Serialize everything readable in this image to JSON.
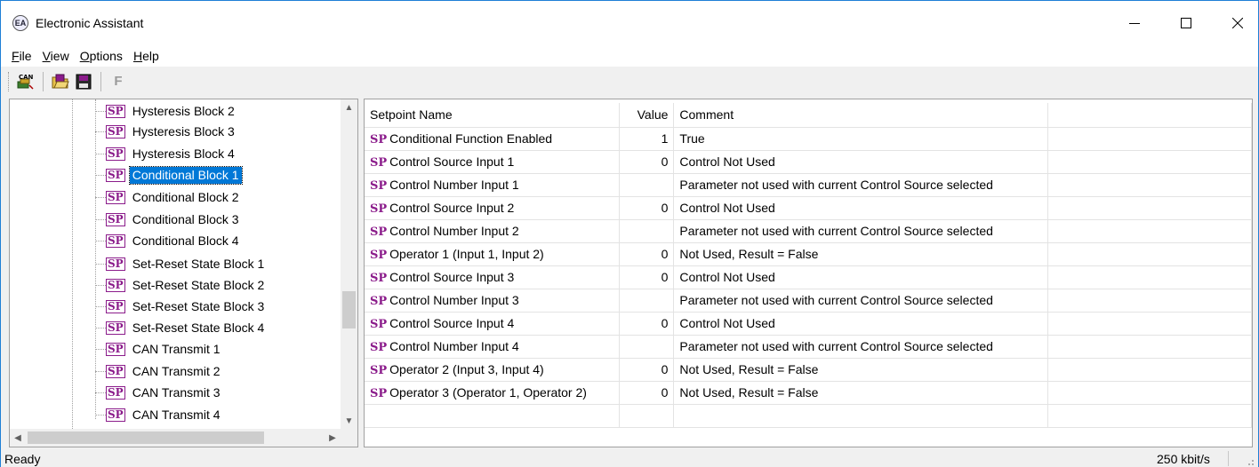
{
  "window": {
    "title": "Electronic Assistant",
    "app_icon": "EA"
  },
  "menu": {
    "items": [
      {
        "key": "F",
        "rest": "ile"
      },
      {
        "key": "V",
        "rest": "iew"
      },
      {
        "key": "O",
        "rest": "ptions"
      },
      {
        "key": "H",
        "rest": "elp"
      }
    ]
  },
  "toolbar": {
    "can_label": "CAN",
    "f_label": "F"
  },
  "tree": {
    "badge": "SP",
    "items": [
      "Hysteresis Block 2",
      "Hysteresis Block 3",
      "Hysteresis Block 4",
      "Conditional Block 1",
      "Conditional Block 2",
      "Conditional Block 3",
      "Conditional Block 4",
      "Set-Reset State Block 1",
      "Set-Reset State Block 2",
      "Set-Reset State Block 3",
      "Set-Reset State Block 4",
      "CAN Transmit 1",
      "CAN Transmit 2",
      "CAN Transmit 3",
      "CAN Transmit 4"
    ],
    "selected_index": 3
  },
  "grid": {
    "headers": {
      "name": "Setpoint Name",
      "value": "Value",
      "comment": "Comment"
    },
    "badge": "SP",
    "rows": [
      {
        "name": "Conditional Function Enabled",
        "value": "1",
        "comment": "True"
      },
      {
        "name": "Control Source Input 1",
        "value": "0",
        "comment": "Control Not Used"
      },
      {
        "name": "Control Number Input 1",
        "value": "",
        "comment": "Parameter not used with current Control Source selected"
      },
      {
        "name": "Control Source Input 2",
        "value": "0",
        "comment": "Control Not Used"
      },
      {
        "name": "Control Number Input 2",
        "value": "",
        "comment": "Parameter not used with current Control Source selected"
      },
      {
        "name": "Operator 1 (Input 1, Input 2)",
        "value": "0",
        "comment": "Not Used, Result = False"
      },
      {
        "name": "Control Source Input 3",
        "value": "0",
        "comment": "Control Not Used"
      },
      {
        "name": "Control Number Input 3",
        "value": "",
        "comment": "Parameter not used with current Control Source selected"
      },
      {
        "name": "Control Source Input 4",
        "value": "0",
        "comment": "Control Not Used"
      },
      {
        "name": "Control Number Input 4",
        "value": "",
        "comment": "Parameter not used with current Control Source selected"
      },
      {
        "name": "Operator 2 (Input 3, Input 4)",
        "value": "0",
        "comment": "Not Used, Result = False"
      },
      {
        "name": "Operator 3 (Operator 1, Operator 2)",
        "value": "0",
        "comment": "Not Used, Result = False"
      }
    ]
  },
  "status": {
    "left": "Ready",
    "right": "250 kbit/s"
  }
}
